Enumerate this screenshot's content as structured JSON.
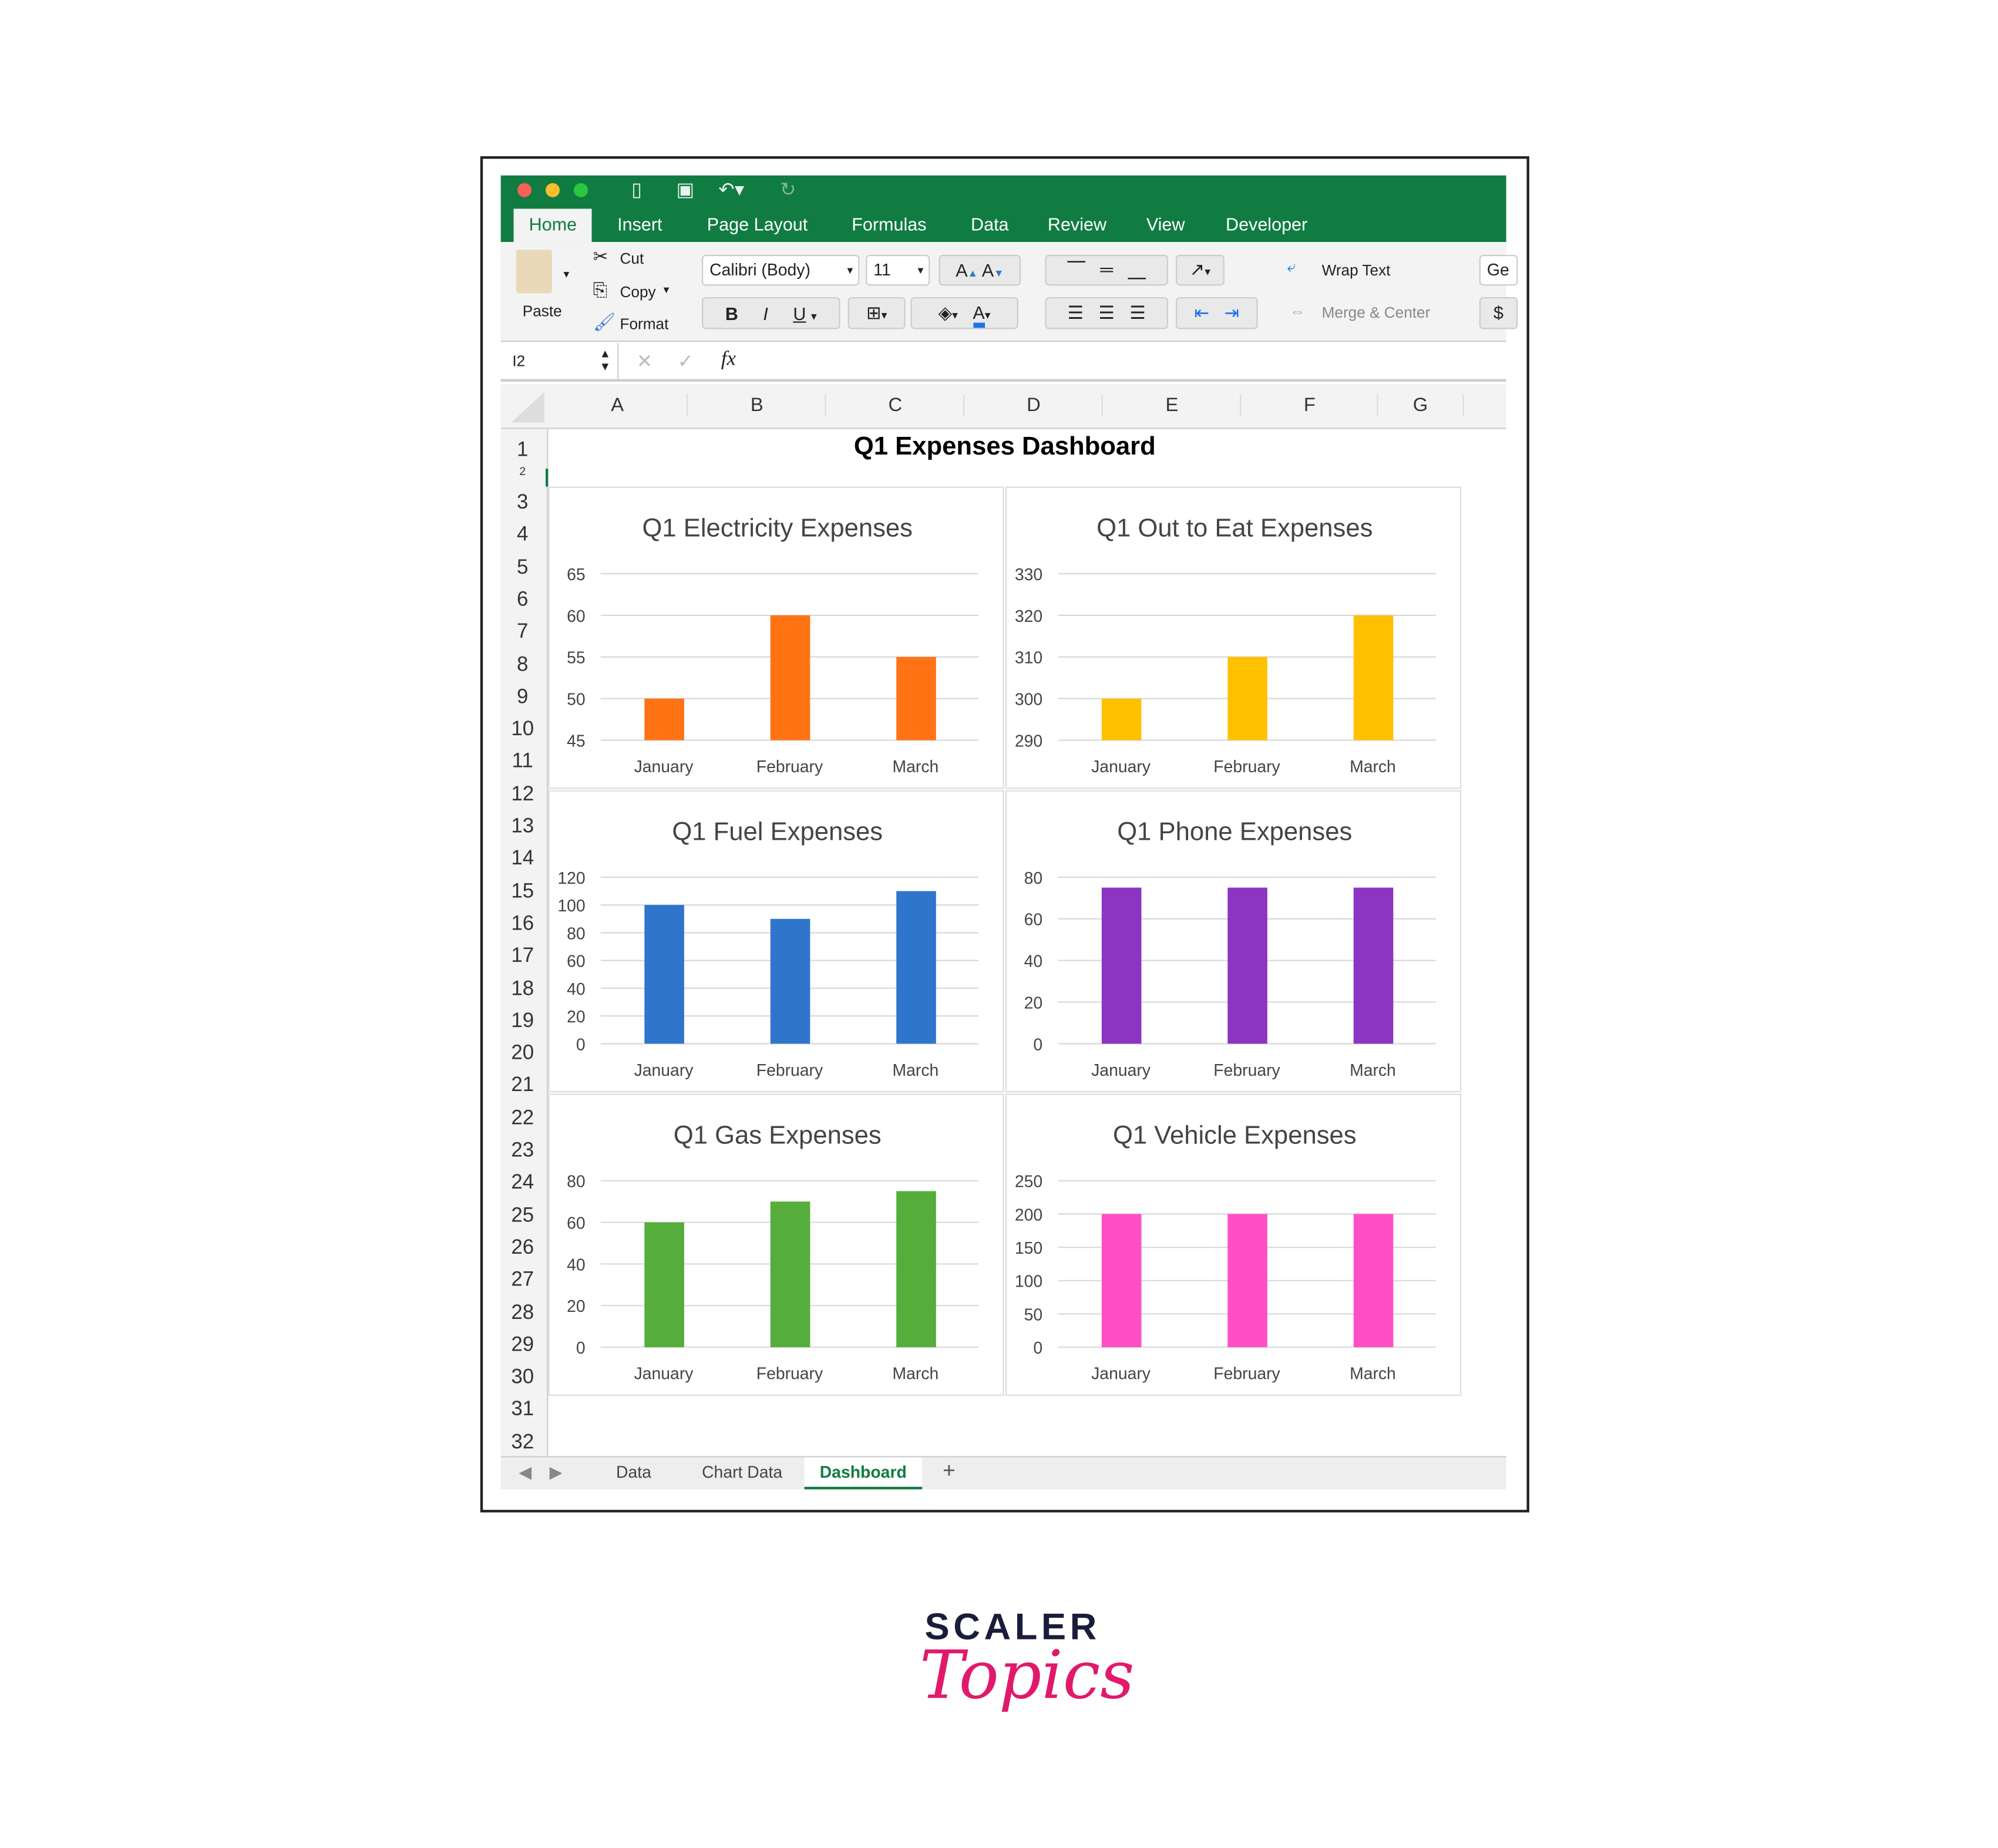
{
  "window": {
    "tabs": [
      "Home",
      "Insert",
      "Page Layout",
      "Formulas",
      "Data",
      "Review",
      "View",
      "Developer"
    ],
    "active_tab": "Home"
  },
  "ribbon": {
    "paste": "Paste",
    "cut": "Cut",
    "copy": "Copy",
    "format": "Format",
    "font": "Calibri (Body)",
    "size": "11",
    "bold": "B",
    "italic": "I",
    "underline": "U",
    "wrap_text": "Wrap Text",
    "merge_center": "Merge & Center",
    "number_format": "Ge",
    "currency": "$",
    "grow": "A",
    "shrink": "A",
    "font_color": "A"
  },
  "formula_bar": {
    "cell_ref": "I2",
    "fx": "fx",
    "value": ""
  },
  "columns": [
    "A",
    "B",
    "C",
    "D",
    "E",
    "F",
    "G"
  ],
  "rows": [
    "1",
    "2",
    "3",
    "4",
    "5",
    "6",
    "7",
    "8",
    "9",
    "10",
    "11",
    "12",
    "13",
    "14",
    "15",
    "16",
    "17",
    "18",
    "19",
    "20",
    "21",
    "22",
    "23",
    "24",
    "25",
    "26",
    "27",
    "28",
    "29",
    "30",
    "31",
    "32"
  ],
  "sheet": {
    "title": "Q1 Expenses Dashboard"
  },
  "sheet_tabs": {
    "items": [
      "Data",
      "Chart Data",
      "Dashboard"
    ],
    "active": "Dashboard",
    "add": "+"
  },
  "logo": {
    "line1": "SCALER",
    "line2": "Topics"
  },
  "chart_data": [
    {
      "type": "bar",
      "title": "Q1 Electricity Expenses",
      "categories": [
        "January",
        "February",
        "March"
      ],
      "values": [
        50,
        60,
        55
      ],
      "ylim": [
        45,
        65
      ],
      "ticks": [
        45,
        50,
        55,
        60,
        65
      ],
      "color": "#ff7315",
      "grid": true
    },
    {
      "type": "bar",
      "title": "Q1 Out to Eat Expenses",
      "categories": [
        "January",
        "February",
        "March"
      ],
      "values": [
        300,
        310,
        320
      ],
      "ylim": [
        290,
        330
      ],
      "ticks": [
        290,
        300,
        310,
        320,
        330
      ],
      "color": "#ffc000",
      "grid": true
    },
    {
      "type": "bar",
      "title": "Q1 Fuel Expenses",
      "categories": [
        "January",
        "February",
        "March"
      ],
      "values": [
        100,
        90,
        110
      ],
      "ylim": [
        0,
        120
      ],
      "ticks": [
        0,
        20,
        40,
        60,
        80,
        100,
        120
      ],
      "color": "#3075cc",
      "grid": true
    },
    {
      "type": "bar",
      "title": "Q1 Phone Expenses",
      "categories": [
        "January",
        "February",
        "March"
      ],
      "values": [
        75,
        75,
        75
      ],
      "ylim": [
        0,
        80
      ],
      "ticks": [
        0,
        20,
        40,
        60,
        80
      ],
      "color": "#8b35c2",
      "grid": true
    },
    {
      "type": "bar",
      "title": "Q1 Gas Expenses",
      "categories": [
        "January",
        "February",
        "March"
      ],
      "values": [
        60,
        70,
        75
      ],
      "ylim": [
        0,
        80
      ],
      "ticks": [
        0,
        20,
        40,
        60,
        80
      ],
      "color": "#55ad3b",
      "grid": true
    },
    {
      "type": "bar",
      "title": "Q1 Vehicle Expenses",
      "categories": [
        "January",
        "February",
        "March"
      ],
      "values": [
        200,
        200,
        200
      ],
      "ylim": [
        0,
        250
      ],
      "ticks": [
        0,
        50,
        100,
        150,
        200,
        250
      ],
      "color": "#ff4fc5",
      "grid": true
    }
  ]
}
